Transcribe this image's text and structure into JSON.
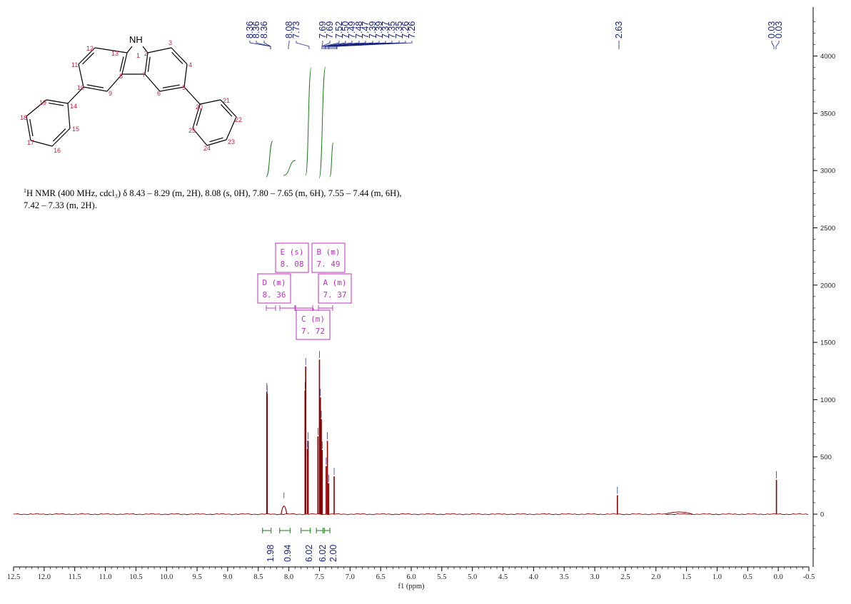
{
  "chart_data": {
    "type": "line",
    "title": "",
    "xlabel": "f1 (ppm)",
    "ylabel": "",
    "xlim": [
      12.5,
      -0.5
    ],
    "ylim": [
      -400,
      4400
    ],
    "x_ticks": [
      "12.5",
      "12.0",
      "11.5",
      "11.0",
      "10.5",
      "10.0",
      "9.5",
      "9.0",
      "8.5",
      "8.0",
      "7.5",
      "7.0",
      "6.5",
      "6.0",
      "5.5",
      "5.0",
      "4.5",
      "4.0",
      "3.5",
      "3.0",
      "2.5",
      "2.0",
      "1.5",
      "1.0",
      "0.5",
      "0.0",
      "-0.5"
    ],
    "y_ticks": [
      "0",
      "500",
      "1000",
      "1500",
      "2000",
      "2500",
      "3000",
      "3500",
      "4000"
    ],
    "peaks": [
      {
        "x": 8.36,
        "y": 1070
      },
      {
        "x": 8.355,
        "y": 1050
      },
      {
        "x": 8.08,
        "y": 90
      },
      {
        "x": 7.735,
        "y": 1080
      },
      {
        "x": 7.725,
        "y": 1290
      },
      {
        "x": 7.695,
        "y": 570
      },
      {
        "x": 7.685,
        "y": 640
      },
      {
        "x": 7.525,
        "y": 680
      },
      {
        "x": 7.5,
        "y": 1350
      },
      {
        "x": 7.485,
        "y": 1020
      },
      {
        "x": 7.47,
        "y": 830
      },
      {
        "x": 7.455,
        "y": 560
      },
      {
        "x": 7.39,
        "y": 420
      },
      {
        "x": 7.37,
        "y": 640
      },
      {
        "x": 7.35,
        "y": 270
      },
      {
        "x": 7.26,
        "y": 330
      },
      {
        "x": 2.63,
        "y": 165
      },
      {
        "x": 0.03,
        "y": 300
      }
    ],
    "peak_labels": [
      "8.36",
      "8.36",
      "8.36",
      "8.08",
      "7.73",
      "7.69",
      "7.69",
      "7.52",
      "7.50",
      "7.49",
      "7.48",
      "7.47",
      "7.39",
      "7.39",
      "7.37",
      "7.35",
      "7.35",
      "7.26",
      "7.26",
      "2.63",
      "0.03",
      "0.03"
    ],
    "integrals": [
      {
        "from": 8.43,
        "to": 8.29,
        "value": "1.98"
      },
      {
        "from": 8.15,
        "to": 7.98,
        "value": "0.94"
      },
      {
        "from": 7.8,
        "to": 7.65,
        "value": "6.02"
      },
      {
        "from": 7.55,
        "to": 7.44,
        "value": "6.02"
      },
      {
        "from": 7.42,
        "to": 7.33,
        "value": "2.00"
      }
    ],
    "multiplets": [
      {
        "label": "E (s)",
        "shift": "8.08"
      },
      {
        "label": "B (m)",
        "shift": "7.49"
      },
      {
        "label": "D (m)",
        "shift": "8.36"
      },
      {
        "label": "A (m)",
        "shift": "7.37"
      },
      {
        "label": "C (m)",
        "shift": "7.72"
      }
    ]
  },
  "molecule": {
    "nh": "NH",
    "atom_numbers": [
      "1",
      "2",
      "3",
      "4",
      "5",
      "6",
      "7",
      "8",
      "9",
      "10",
      "11",
      "12",
      "13",
      "14",
      "15",
      "16",
      "17",
      "18",
      "19",
      "20",
      "21",
      "22",
      "23",
      "24",
      "25"
    ]
  },
  "nmr_text": {
    "sup": "1",
    "line1": "H NMR (400 MHz, cdcl₃) δ 8.43 – 8.29 (m, 2H), 8.08 (s, 0H), 7.80 – 7.65 (m, 6H), 7.55 – 7.44 (m, 6H),",
    "line2": "7.42 – 7.33 (m, 2H)."
  },
  "colors": {
    "spectrum": "#8b0000",
    "integral": "#1b7a1b",
    "peak_label": "#1a237e",
    "multiplet_box": "#c12fc1",
    "atom_number": "#d81b3b"
  }
}
